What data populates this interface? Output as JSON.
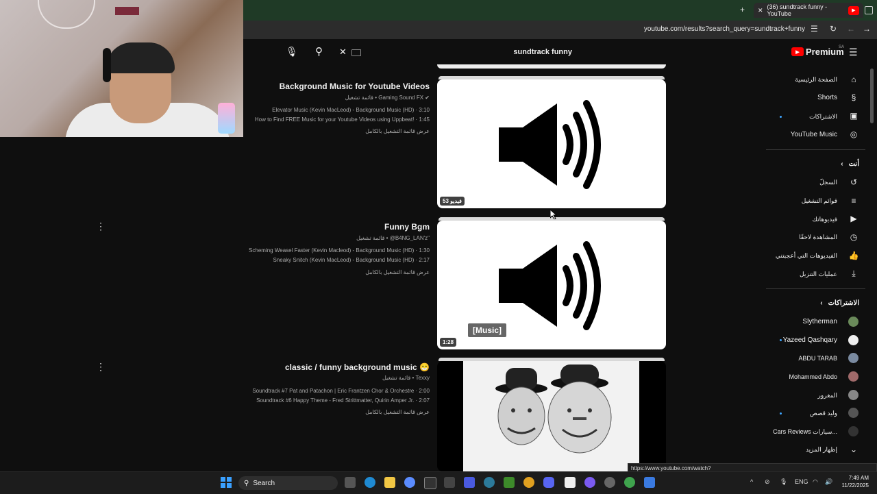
{
  "browser": {
    "tab_title": "(36) sundtrack funny - YouTube",
    "url": "youtube.com/results?search_query=sundtrack+funny",
    "new_tab_symbol": "+",
    "close_symbol": "✕"
  },
  "masthead": {
    "search_query": "sundtrack funny",
    "premium_label": "Premium",
    "region": "SA"
  },
  "results": [
    {
      "title": "Background Music for Youtube Videos",
      "channel": "Gaming Sound FX",
      "type": "قائمة تشغيل",
      "videos": [
        "Elevator Music (Kevin MacLeod) - Background Music (HD) · 3:10",
        "How to Find FREE Music for your Youtube Videos using Uppbeat! · 1:45"
      ],
      "view_full": "عرض قائمة التشغيل بالكامل",
      "badge": "53 فيديو"
    },
    {
      "title": "Funny Bgm",
      "channel": "@B4NG_LAN'z\"",
      "type": "قائمة تشغيل",
      "videos": [
        "Scheming Weasel Faster (Kevin Macleod) - Background Music (HD) · 1:30",
        "Sneaky Snitch (Kevin MacLeod) - Background Music (HD) · 2:17"
      ],
      "view_full": "عرض قائمة التشغيل بالكامل",
      "badge": "1:28",
      "tag": "[Music]"
    },
    {
      "title": "classic / funny background music 😁",
      "channel": "Texxy",
      "type": "قائمة تشغيل",
      "videos": [
        "Soundtrack #7 Pat and Patachon | Eric Frantzen Chor & Orchestre · 2:00",
        "Soundtrack #6 Happy Theme - Fred Strittmatter, Quirin Amper Jr. · 2:07"
      ],
      "view_full": "عرض قائمة التشغيل بالكامل"
    }
  ],
  "sidebar": {
    "main": [
      "الصفحة الرئيسية",
      "Shorts",
      "الاشتراكات",
      "YouTube Music"
    ],
    "you_header": "أنت",
    "you": [
      "السجلّ",
      "قوائم التشغيل",
      "فيديوهاتك",
      "المشاهدة لاحقًا",
      "الفيديوهات التي أعجبتني",
      "عمليات التنزيل"
    ],
    "subs_header": "الاشتراكات",
    "subs": [
      "Slytherman",
      "Yazeed Qashqary",
      "ABDU TARAB",
      "Mohammed Abdo",
      "المغرور",
      "وليد قصص",
      "Cars Reviews سيارات..."
    ],
    "show_more": "إظهار المزيد"
  },
  "status_bar_url": "https://www.youtube.com/watch?v=Xi69bl9vKDg&list=PLQhV1UQNSo1VedBesiYN0p0om9Hbc8dPm",
  "taskbar": {
    "search_label": "Search",
    "lang": "ENG",
    "time": "7:49 AM",
    "date": "11/22/2025"
  },
  "colors": {
    "youtube_red": "#ff0000",
    "accent_blue": "#3ea6ff"
  }
}
